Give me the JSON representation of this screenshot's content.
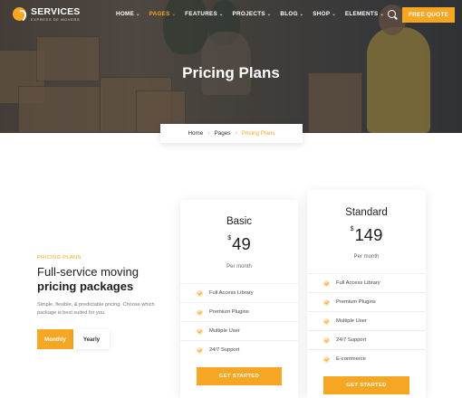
{
  "header": {
    "logo_title": "SERVICES",
    "logo_subtitle": "EXPRESS DE MOVERS",
    "nav": [
      {
        "label": "HOME",
        "active": false
      },
      {
        "label": "PAGES",
        "active": true
      },
      {
        "label": "FEATURES",
        "active": false
      },
      {
        "label": "PROJECTS",
        "active": false
      },
      {
        "label": "BLOG",
        "active": false
      },
      {
        "label": "SHOP",
        "active": false
      },
      {
        "label": "ELEMENTS",
        "active": false
      }
    ],
    "search_icon": "search-icon",
    "quote_button": "FREE QUOTE"
  },
  "hero": {
    "title": "Pricing Plans"
  },
  "breadcrumb": {
    "items": [
      "Home",
      "Pages"
    ],
    "current": "Pricing Plans"
  },
  "intro": {
    "eyebrow": "PRICING PLANS",
    "heading_line1": "Full-service moving",
    "heading_line2": "pricing packages",
    "description": "Simple, flexible, & predictable pricing. Choose which package is best suited for you.",
    "toggle": {
      "monthly": "Monthly",
      "yearly": "Yearly",
      "selected": "Monthly"
    }
  },
  "plans": [
    {
      "name": "Basic",
      "currency": "$",
      "price": "49",
      "period": "Per month",
      "features": [
        "Full Access Library",
        "Premium Plugins",
        "Multiple User",
        "24/7 Support"
      ],
      "cta": "GET STARTED"
    },
    {
      "name": "Standard",
      "currency": "$",
      "price": "149",
      "period": "Per month",
      "features": [
        "Full Access Library",
        "Premium Plugins",
        "Multiple User",
        "24/7 Support",
        "E-commerce"
      ],
      "cta": "GET STARTED"
    }
  ],
  "colors": {
    "accent": "#f5a623",
    "text_dark": "#1d1d1d",
    "text_muted": "#777777"
  }
}
